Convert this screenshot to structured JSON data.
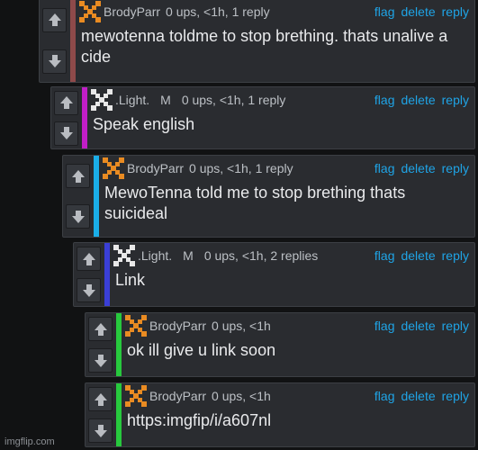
{
  "actions": {
    "flag": "flag",
    "delete": "delete",
    "reply": "reply"
  },
  "watermark": "imgflip.com",
  "comments": [
    {
      "username": "BrodyParr",
      "mod_badge": "",
      "meta": "0 ups, <1h, 1 reply",
      "text": "mewotenna toldme to stop brething. thats unalive a cide",
      "bar_color": "#8e4a4a",
      "avatar": "orange-x-icon"
    },
    {
      "username": ".Light.",
      "mod_badge": "M",
      "meta": "0 ups, <1h, 1 reply",
      "text": "Speak english",
      "bar_color": "#c21ec7",
      "avatar": "white-x-icon"
    },
    {
      "username": "BrodyParr",
      "mod_badge": "",
      "meta": "0 ups, <1h, 1 reply",
      "text": "MewoTenna told me to stop brething thats suicideal",
      "bar_color": "#1aaee8",
      "avatar": "orange-x-icon"
    },
    {
      "username": ".Light.",
      "mod_badge": "M",
      "meta": "0 ups, <1h, 2 replies",
      "text": "Link",
      "bar_color": "#3a3fd6",
      "avatar": "white-x-icon"
    },
    {
      "username": "BrodyParr",
      "mod_badge": "",
      "meta": "0 ups, <1h",
      "text": "ok ill give u link soon",
      "bar_color": "#27c93d",
      "avatar": "orange-x-icon"
    },
    {
      "username": "BrodyParr",
      "mod_badge": "",
      "meta": "0 ups, <1h",
      "text": "https:imgfip/i/a607nl",
      "bar_color": "#27c93d",
      "avatar": "orange-x-icon"
    }
  ]
}
